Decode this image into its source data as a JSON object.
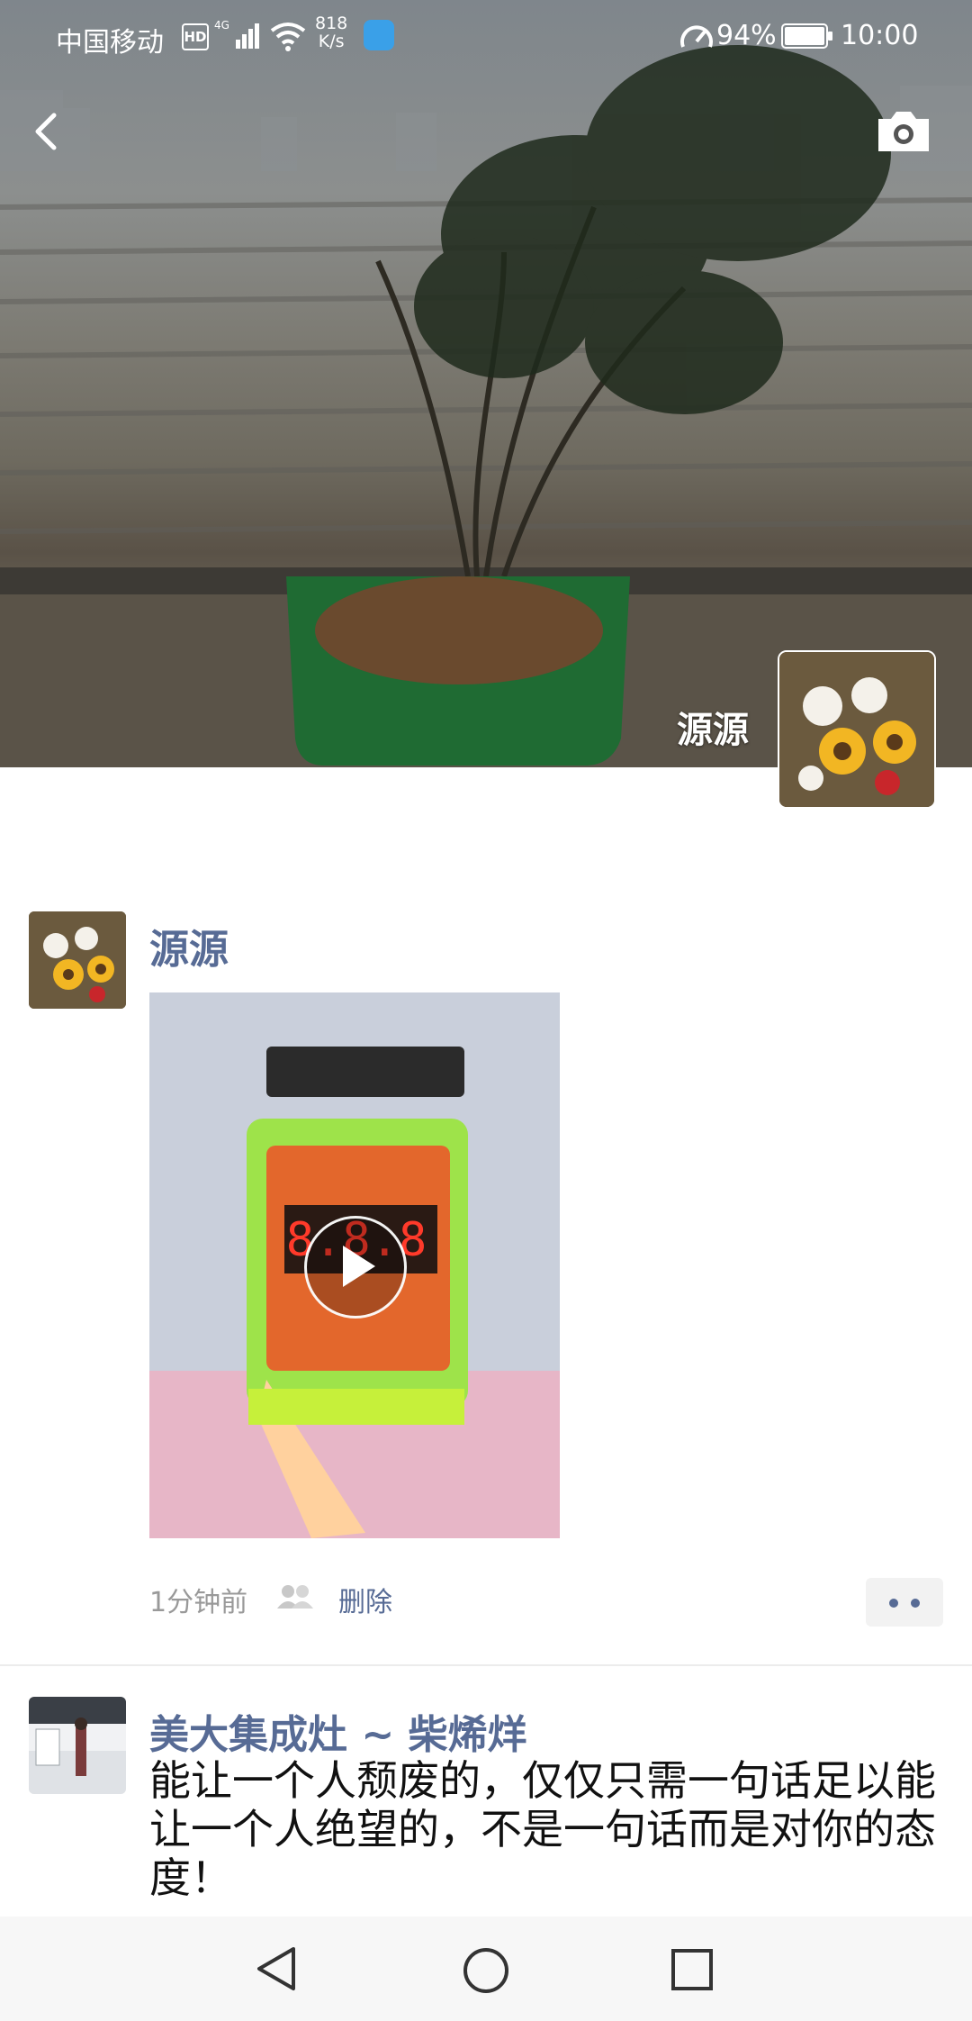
{
  "status_bar": {
    "carrier": "中国移动",
    "hd": "HD",
    "network": "4G",
    "speed_value": "818",
    "speed_unit": "K/s",
    "battery": "94%",
    "time": "10:00"
  },
  "cover": {
    "name": "源源"
  },
  "posts": [
    {
      "author": "源源",
      "media": "video",
      "time": "1分钟前",
      "delete_label": "删除"
    },
    {
      "author": "美大集成灶 ~ 柴烯烊",
      "text": "能让一个人颓废的，仅仅只需一句话足以能让一个人绝望的，不是一句话而是对你的态度！"
    }
  ],
  "icons": {
    "back": "chevron-left-icon",
    "camera": "camera-icon",
    "play": "play-icon",
    "friends": "friends-icon",
    "more": "more-dots-icon"
  },
  "colors": {
    "link": "#576b95",
    "meta": "#999999",
    "nav_bg": "#f7f7f7"
  }
}
